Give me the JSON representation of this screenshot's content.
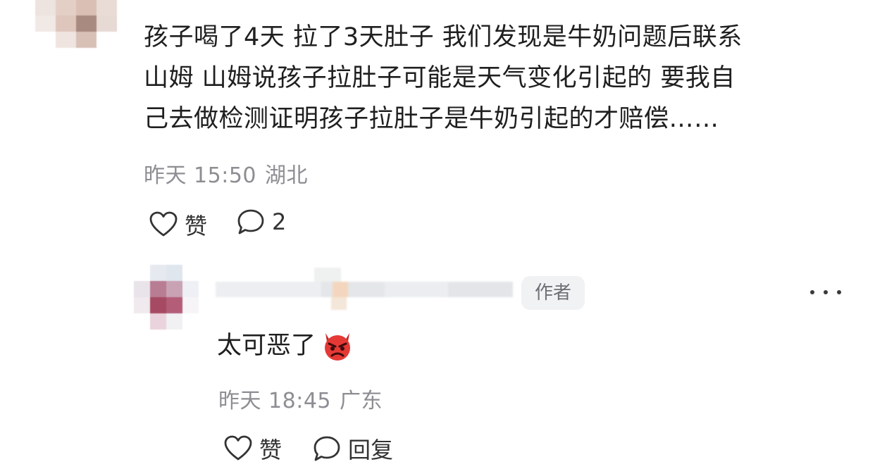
{
  "comment": {
    "lines": [
      "孩子喝了4天 拉了3天肚子 我们发现是牛奶问题后联系",
      "山姆 山姆说孩子拉肚子可能是天气变化引起的 要我自",
      "己去做检测证明孩子拉肚子是牛奶引起的才赔偿……"
    ],
    "time": "昨天 15:50",
    "location": "湖北",
    "like_label": "赞",
    "reply_count": "2",
    "like_icon": "heart-outline-icon",
    "reply_icon": "speech-bubble-icon"
  },
  "reply": {
    "author_badge": "作者",
    "text": "太可恶了",
    "emoji": "angry-devil-emoji",
    "time": "昨天 18:45",
    "location": "广东",
    "like_label": "赞",
    "reply_label": "回复",
    "more_icon": "ellipsis-icon"
  },
  "colors": {
    "meta_text": "#8d8d93",
    "badge_bg": "#f1f2f4",
    "emoji_red": "#e53935"
  }
}
